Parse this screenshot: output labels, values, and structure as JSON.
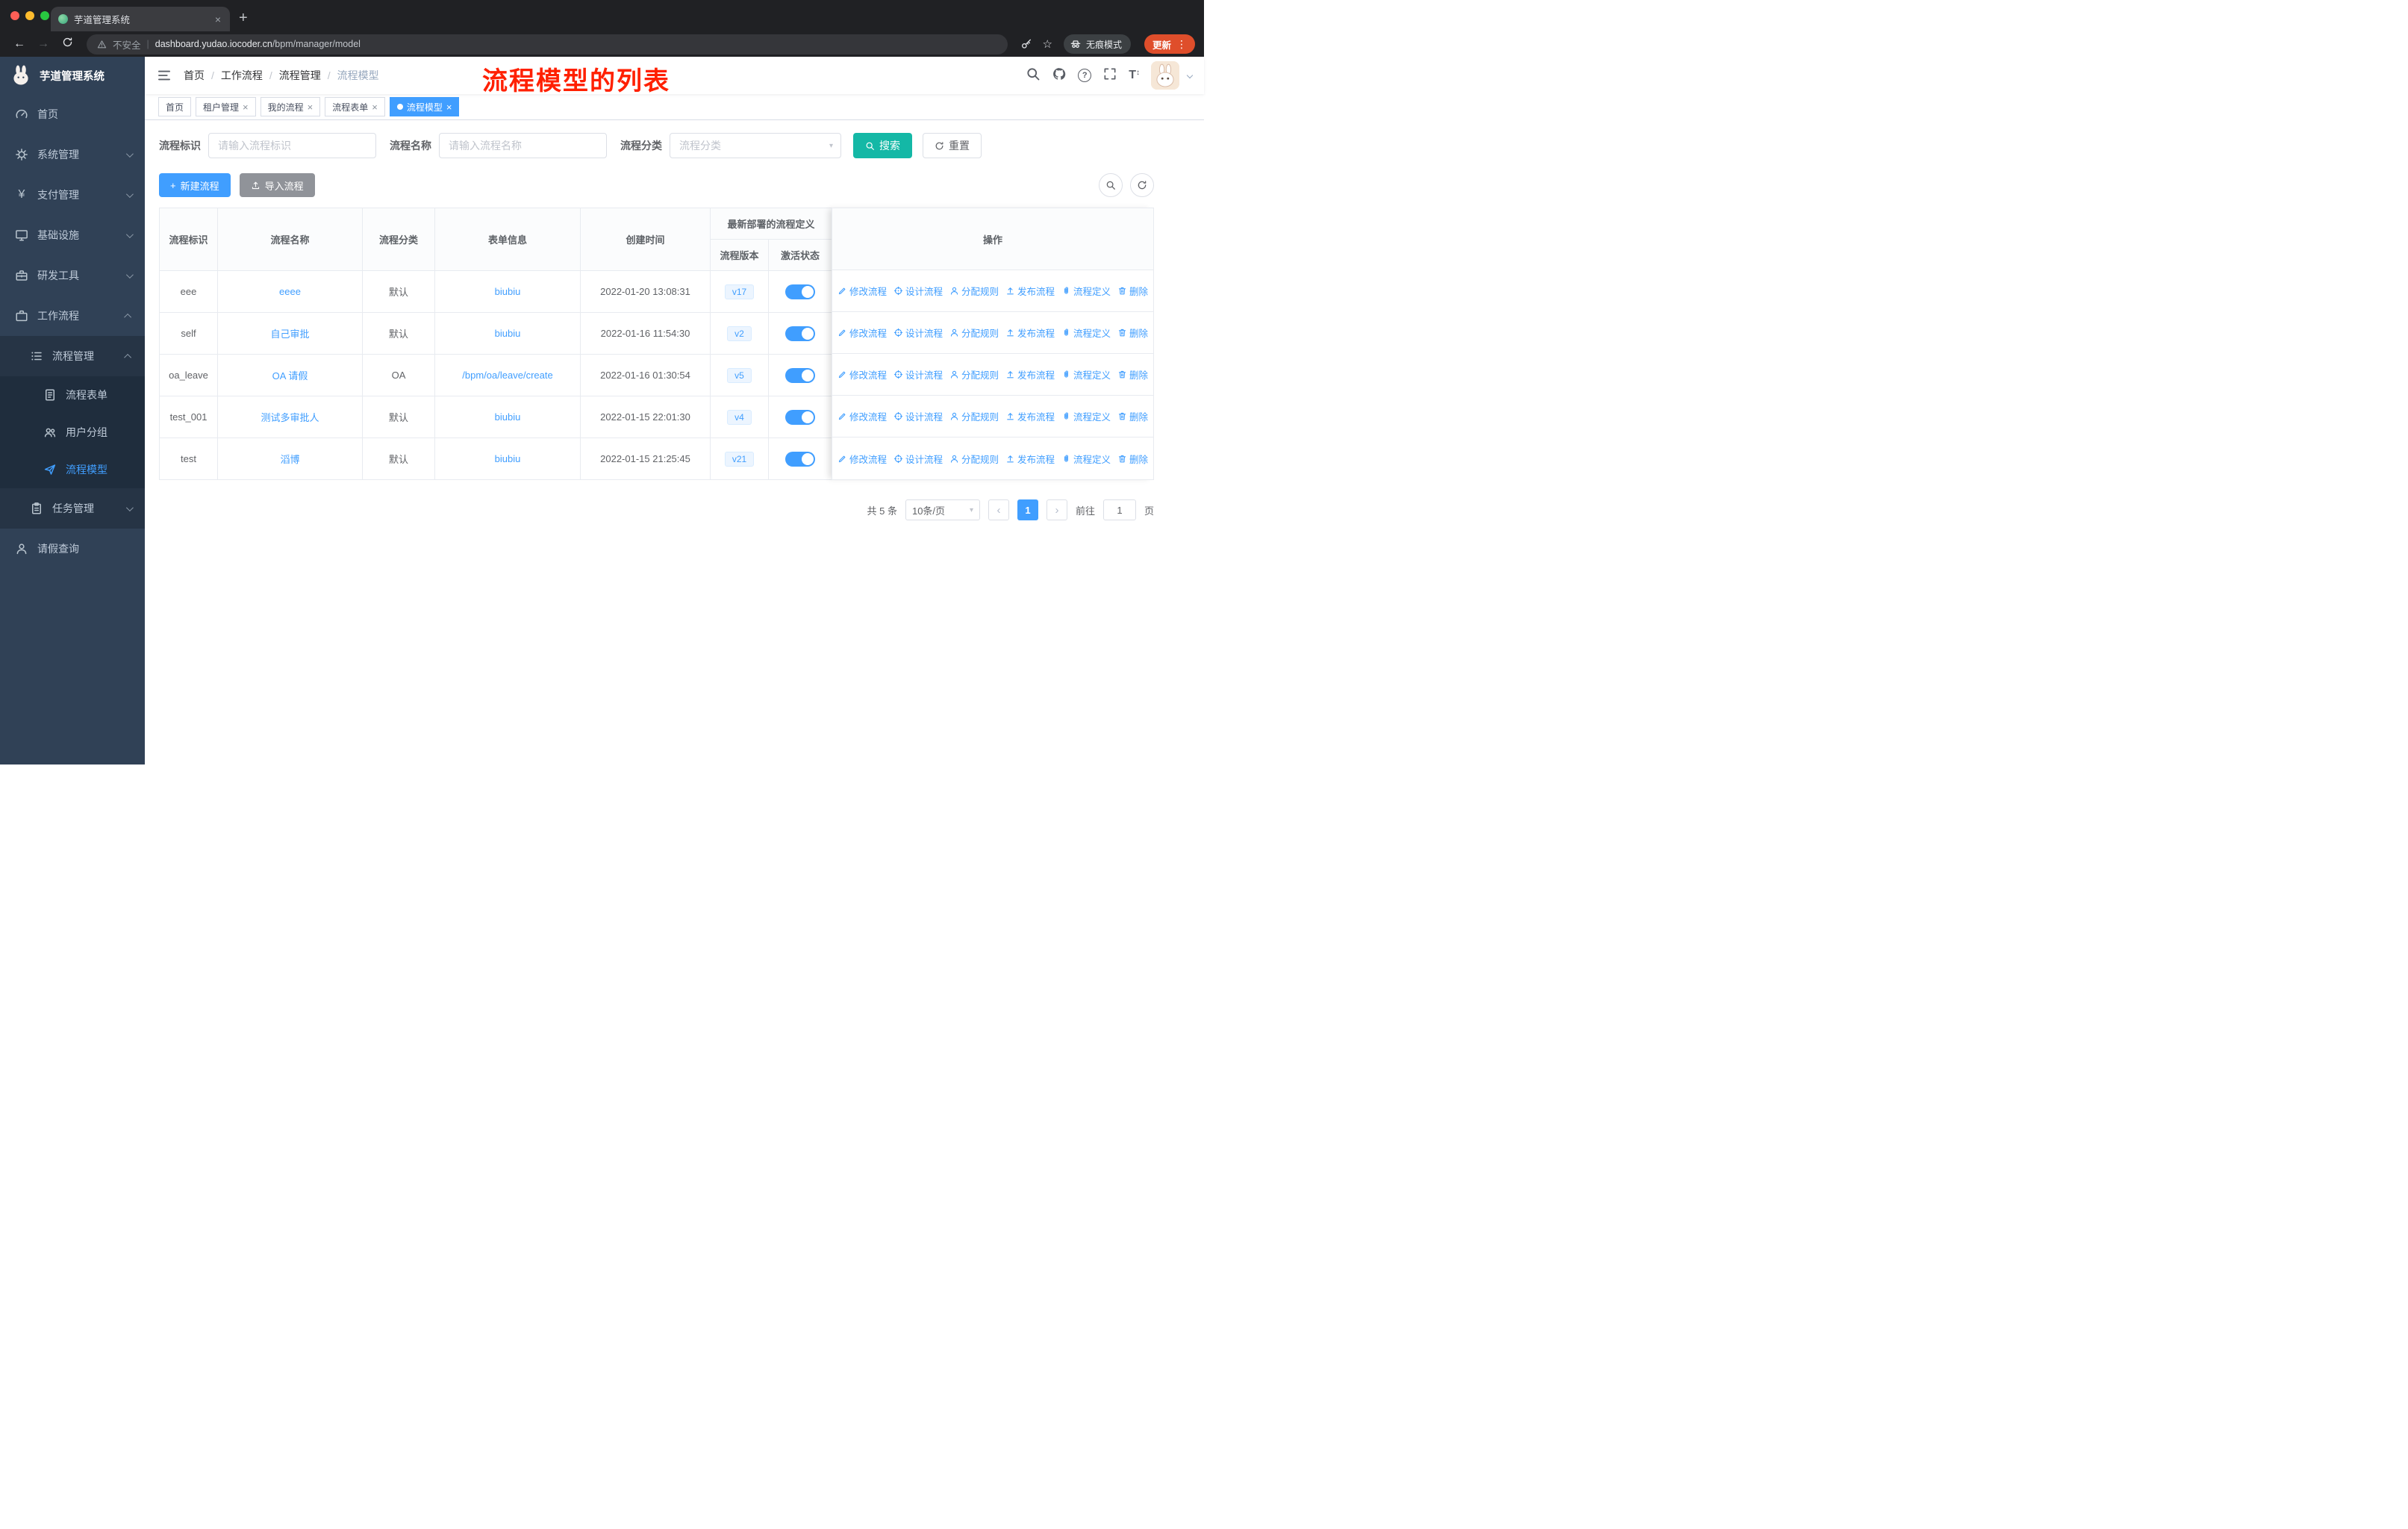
{
  "colors": {
    "primary": "#409eff",
    "search_button": "#14b8a6",
    "annotation": "#ff2000",
    "sidebar_bg": "#304156",
    "update_chip": "#df4e2b"
  },
  "browser": {
    "tab_title": "芋道管理系统",
    "security_label": "不安全",
    "url_domain": "dashboard.yudao.iocoder.cn",
    "url_path": "/bpm/manager/model",
    "incognito_label": "无痕模式",
    "update_label": "更新"
  },
  "sidebar": {
    "title": "芋道管理系统",
    "items": [
      {
        "label": "首页"
      },
      {
        "label": "系统管理"
      },
      {
        "label": "支付管理"
      },
      {
        "label": "基础设施"
      },
      {
        "label": "研发工具"
      },
      {
        "label": "工作流程"
      },
      {
        "label": "流程管理"
      },
      {
        "label": "流程表单"
      },
      {
        "label": "用户分组"
      },
      {
        "label": "流程模型"
      },
      {
        "label": "任务管理"
      },
      {
        "label": "请假查询"
      }
    ]
  },
  "navbar": {
    "breadcrumb": [
      "首页",
      "工作流程",
      "流程管理",
      "流程模型"
    ],
    "annotation": "流程模型的列表"
  },
  "tags": [
    {
      "label": "首页"
    },
    {
      "label": "租户管理"
    },
    {
      "label": "我的流程"
    },
    {
      "label": "流程表单"
    },
    {
      "label": "流程模型"
    }
  ],
  "filters": {
    "key_label": "流程标识",
    "key_placeholder": "请输入流程标识",
    "name_label": "流程名称",
    "name_placeholder": "请输入流程名称",
    "category_label": "流程分类",
    "category_placeholder": "流程分类",
    "search_label": "搜索",
    "reset_label": "重置"
  },
  "toolbar": {
    "create_label": "新建流程",
    "import_label": "导入流程"
  },
  "table": {
    "headers": {
      "key": "流程标识",
      "name": "流程名称",
      "category": "流程分类",
      "form": "表单信息",
      "created": "创建时间",
      "group": "最新部署的流程定义",
      "version": "流程版本",
      "active": "激活状态",
      "actions": "操作"
    },
    "rows": [
      {
        "key": "eee",
        "name": "eeee",
        "category": "默认",
        "form": "biubiu",
        "created": "2022-01-20 13:08:31",
        "version": "v17",
        "active": true
      },
      {
        "key": "self",
        "name": "自己审批",
        "category": "默认",
        "form": "biubiu",
        "created": "2022-01-16 11:54:30",
        "version": "v2",
        "active": true
      },
      {
        "key": "oa_leave",
        "name": "OA 请假",
        "category": "OA",
        "form": "/bpm/oa/leave/create",
        "created": "2022-01-16 01:30:54",
        "version": "v5",
        "active": true
      },
      {
        "key": "test_001",
        "name": "测试多审批人",
        "category": "默认",
        "form": "biubiu",
        "created": "2022-01-15 22:01:30",
        "version": "v4",
        "active": true
      },
      {
        "key": "test",
        "name": "滔博",
        "category": "默认",
        "form": "biubiu",
        "created": "2022-01-15 21:25:45",
        "version": "v21",
        "active": true
      }
    ],
    "actions": [
      {
        "label": "修改流程"
      },
      {
        "label": "设计流程"
      },
      {
        "label": "分配规则"
      },
      {
        "label": "发布流程"
      },
      {
        "label": "流程定义"
      },
      {
        "label": "删除"
      }
    ]
  },
  "pagination": {
    "total": "共 5 条",
    "size": "10条/页",
    "page": "1",
    "goto_label": "前往",
    "goto_value": "1",
    "unit_label": "页"
  }
}
